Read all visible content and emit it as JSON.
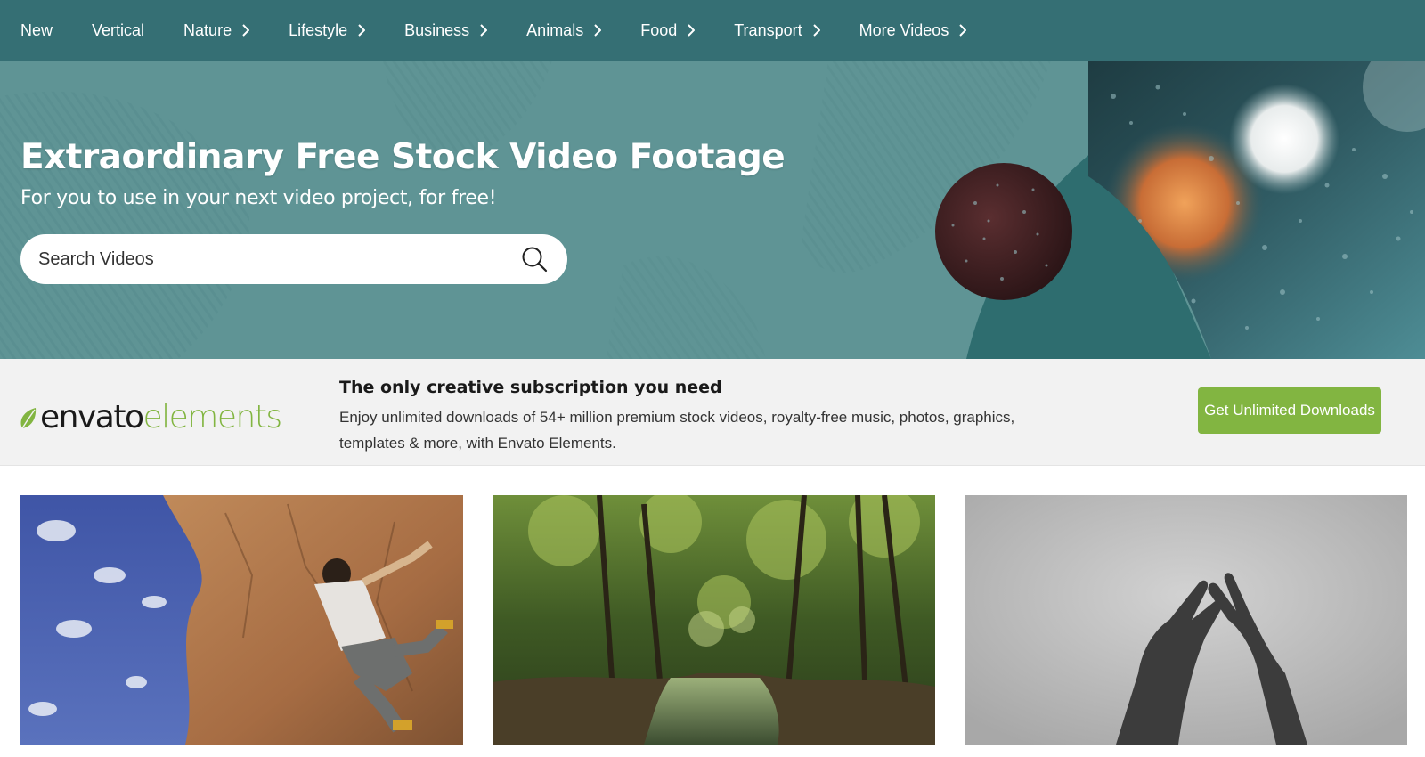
{
  "nav": {
    "items": [
      {
        "label": "New",
        "has_submenu": false
      },
      {
        "label": "Vertical",
        "has_submenu": false
      },
      {
        "label": "Nature",
        "has_submenu": true
      },
      {
        "label": "Lifestyle",
        "has_submenu": true
      },
      {
        "label": "Business",
        "has_submenu": true
      },
      {
        "label": "Animals",
        "has_submenu": true
      },
      {
        "label": "Food",
        "has_submenu": true
      },
      {
        "label": "Transport",
        "has_submenu": true
      },
      {
        "label": "More Videos",
        "has_submenu": true
      }
    ]
  },
  "hero": {
    "title": "Extraordinary Free Stock Video Footage",
    "subtitle": "For you to use in your next video project, for free!",
    "search_placeholder": "Search Videos",
    "search_icon": "search-icon"
  },
  "promo": {
    "logo_part1": "envato",
    "logo_part2": "elements",
    "title": "The only creative subscription you need",
    "text": "Enjoy unlimited downloads of 54+ million premium stock videos, royalty-free music, photos, graphics, templates & more, with Envato Elements.",
    "button_label": "Get Unlimited Downloads"
  },
  "colors": {
    "nav_bg": "#356f74",
    "hero_bg": "#5f9495",
    "accent_green": "#82b541",
    "promo_bg": "#f2f2f2"
  },
  "thumbnails": [
    {
      "subject": "rock-climber"
    },
    {
      "subject": "forest-stream"
    },
    {
      "subject": "hands-shadow"
    }
  ]
}
